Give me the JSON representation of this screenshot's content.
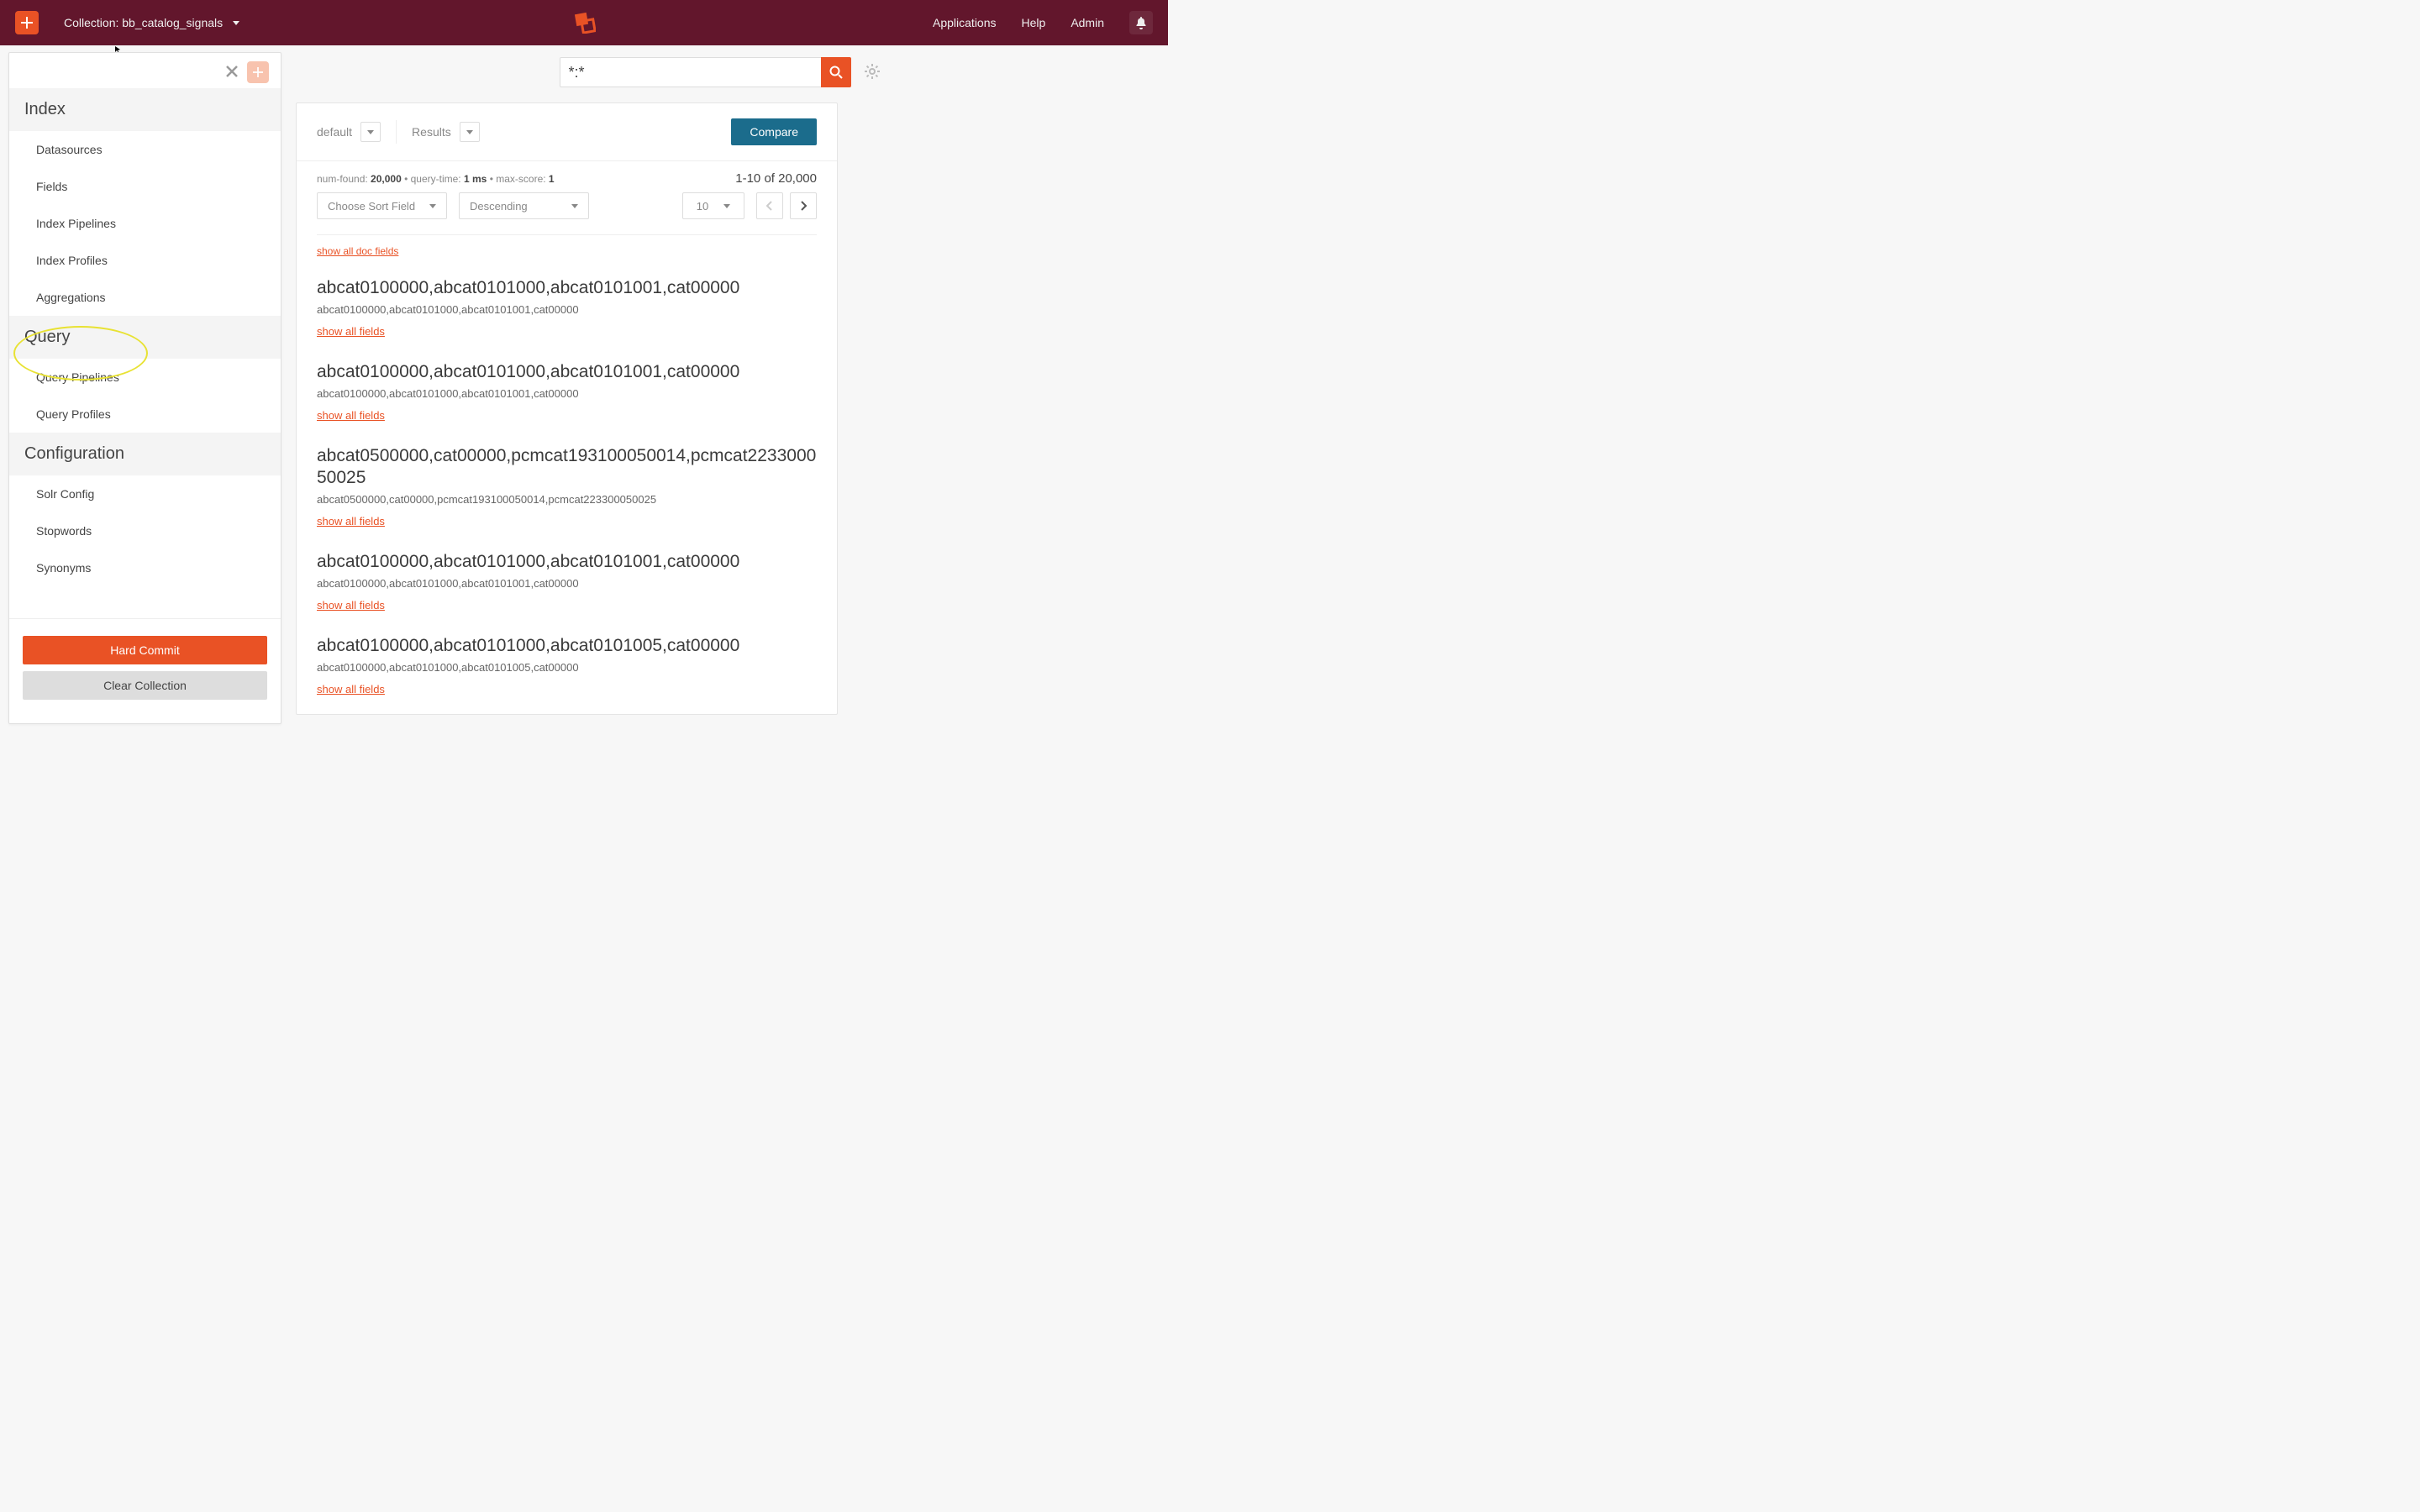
{
  "topbar": {
    "collection_label": "Collection: bb_catalog_signals",
    "nav": {
      "applications": "Applications",
      "help": "Help",
      "admin": "Admin"
    }
  },
  "sidebar": {
    "sections": {
      "index": {
        "title": "Index",
        "items": [
          "Datasources",
          "Fields",
          "Index Pipelines",
          "Index Profiles",
          "Aggregations"
        ]
      },
      "query": {
        "title": "Query",
        "items": [
          "Query Pipelines",
          "Query Profiles"
        ]
      },
      "config": {
        "title": "Configuration",
        "items": [
          "Solr Config",
          "Stopwords",
          "Synonyms"
        ]
      }
    },
    "hard_commit": "Hard Commit",
    "clear_collection": "Clear Collection"
  },
  "search": {
    "value": "*:*"
  },
  "controls": {
    "left_label": "default",
    "right_label": "Results",
    "compare": "Compare",
    "num_found_label": "num-found:",
    "num_found": "20,000",
    "query_time_label": "query-time:",
    "query_time": "1 ms",
    "max_score_label": "max-score:",
    "max_score": "1",
    "range": "1-10 of 20,000",
    "sort_placeholder": "Choose Sort Field",
    "order_placeholder": "Descending",
    "per_page": "10",
    "show_all_doc": "show all doc fields",
    "show_all": "show all fields"
  },
  "results": [
    {
      "title": "abcat0100000,abcat0101000,abcat0101001,cat00000",
      "sub": "abcat0100000,abcat0101000,abcat0101001,cat00000"
    },
    {
      "title": "abcat0100000,abcat0101000,abcat0101001,cat00000",
      "sub": "abcat0100000,abcat0101000,abcat0101001,cat00000"
    },
    {
      "title": "abcat0500000,cat00000,pcmcat193100050014,pcmcat223300050025",
      "sub": "abcat0500000,cat00000,pcmcat193100050014,pcmcat223300050025"
    },
    {
      "title": "abcat0100000,abcat0101000,abcat0101001,cat00000",
      "sub": "abcat0100000,abcat0101000,abcat0101001,cat00000"
    },
    {
      "title": "abcat0100000,abcat0101000,abcat0101005,cat00000",
      "sub": "abcat0100000,abcat0101000,abcat0101005,cat00000"
    }
  ]
}
